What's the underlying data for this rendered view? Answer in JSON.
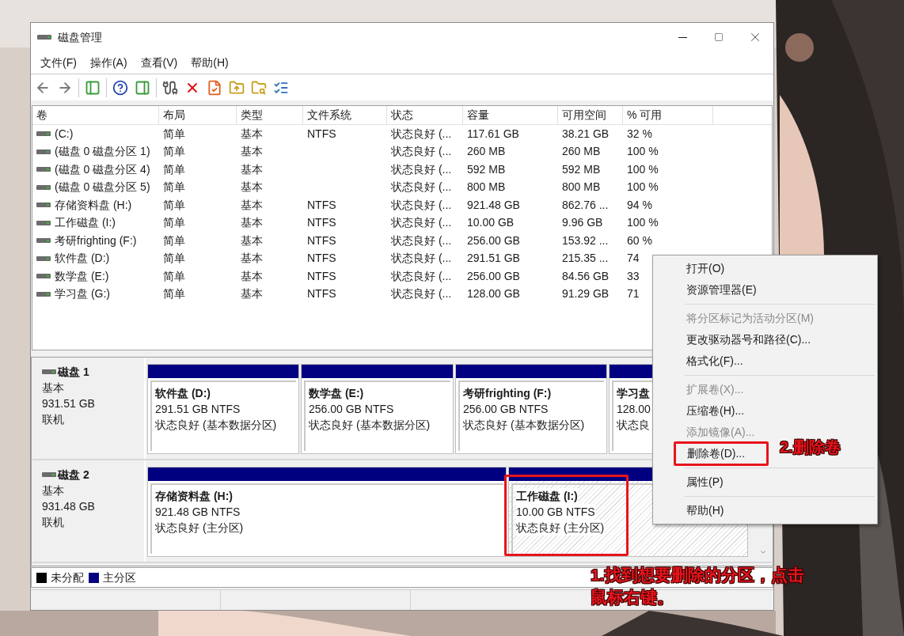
{
  "window": {
    "title": "磁盘管理"
  },
  "menu_bar": [
    "文件(F)",
    "操作(A)",
    "查看(V)",
    "帮助(H)"
  ],
  "volume_table": {
    "columns": [
      "卷",
      "布局",
      "类型",
      "文件系统",
      "状态",
      "容量",
      "可用空间",
      "% 可用"
    ],
    "rows": [
      [
        "(C:)",
        "简单",
        "基本",
        "NTFS",
        "状态良好 (...",
        "117.61 GB",
        "38.21 GB",
        "32 %"
      ],
      [
        "(磁盘 0 磁盘分区 1)",
        "简单",
        "基本",
        "",
        "状态良好 (...",
        "260 MB",
        "260 MB",
        "100 %"
      ],
      [
        "(磁盘 0 磁盘分区 4)",
        "简单",
        "基本",
        "",
        "状态良好 (...",
        "592 MB",
        "592 MB",
        "100 %"
      ],
      [
        "(磁盘 0 磁盘分区 5)",
        "简单",
        "基本",
        "",
        "状态良好 (...",
        "800 MB",
        "800 MB",
        "100 %"
      ],
      [
        "存储资料盘 (H:)",
        "简单",
        "基本",
        "NTFS",
        "状态良好 (...",
        "921.48 GB",
        "862.76 ...",
        "94 %"
      ],
      [
        "工作磁盘 (I:)",
        "简单",
        "基本",
        "NTFS",
        "状态良好 (...",
        "10.00 GB",
        "9.96 GB",
        "100 %"
      ],
      [
        "考研frighting (F:)",
        "简单",
        "基本",
        "NTFS",
        "状态良好 (...",
        "256.00 GB",
        "153.92 ...",
        "60 %"
      ],
      [
        "软件盘 (D:)",
        "简单",
        "基本",
        "NTFS",
        "状态良好 (...",
        "291.51 GB",
        "215.35 ...",
        "74"
      ],
      [
        "数学盘 (E:)",
        "简单",
        "基本",
        "NTFS",
        "状态良好 (...",
        "256.00 GB",
        "84.56 GB",
        "33"
      ],
      [
        "学习盘 (G:)",
        "简单",
        "基本",
        "NTFS",
        "状态良好 (...",
        "128.00 GB",
        "91.29 GB",
        "71"
      ]
    ]
  },
  "disks": [
    {
      "name": "磁盘 1",
      "type": "基本",
      "size": "931.51 GB",
      "status": "联机",
      "partitions": [
        {
          "name": "软件盘  (D:)",
          "size": "291.51 GB NTFS",
          "status": "状态良好 (基本数据分区)",
          "selected": false
        },
        {
          "name": "数学盘  (E:)",
          "size": "256.00 GB NTFS",
          "status": "状态良好 (基本数据分区)",
          "selected": false
        },
        {
          "name": "考研frighting  (F:)",
          "size": "256.00 GB NTFS",
          "status": "状态良好 (基本数据分区)",
          "selected": false
        },
        {
          "name": "学习盘",
          "size": "128.00",
          "status": "状态良",
          "selected": false
        }
      ]
    },
    {
      "name": "磁盘 2",
      "type": "基本",
      "size": "931.48 GB",
      "status": "联机",
      "partitions": [
        {
          "name": "存储资料盘  (H:)",
          "size": "921.48 GB NTFS",
          "status": "状态良好 (主分区)",
          "selected": false
        },
        {
          "name": "工作磁盘  (I:)",
          "size": "10.00 GB NTFS",
          "status": "状态良好 (主分区)",
          "selected": true
        }
      ]
    }
  ],
  "legend": [
    {
      "label": "未分配",
      "color": "#000000"
    },
    {
      "label": "主分区",
      "color": "#000080"
    }
  ],
  "context_menu": [
    {
      "kind": "item",
      "label": "打开(O)",
      "disabled": false
    },
    {
      "kind": "item",
      "label": "资源管理器(E)",
      "disabled": false
    },
    {
      "kind": "separator"
    },
    {
      "kind": "item",
      "label": "将分区标记为活动分区(M)",
      "disabled": true
    },
    {
      "kind": "item",
      "label": "更改驱动器号和路径(C)...",
      "disabled": false
    },
    {
      "kind": "item",
      "label": "格式化(F)...",
      "disabled": false
    },
    {
      "kind": "separator"
    },
    {
      "kind": "item",
      "label": "扩展卷(X)...",
      "disabled": true
    },
    {
      "kind": "item",
      "label": "压缩卷(H)...",
      "disabled": false
    },
    {
      "kind": "item",
      "label": "添加镜像(A)...",
      "disabled": true
    },
    {
      "kind": "item",
      "label": "删除卷(D)...",
      "disabled": false,
      "highlighted": true
    },
    {
      "kind": "separator"
    },
    {
      "kind": "item",
      "label": "属性(P)",
      "disabled": false
    },
    {
      "kind": "separator"
    },
    {
      "kind": "item",
      "label": "帮助(H)",
      "disabled": false
    }
  ],
  "annotations": {
    "step_1": "1.找到想要删除的分区，点击鼠标右键。",
    "step_2": "2.删除卷"
  }
}
